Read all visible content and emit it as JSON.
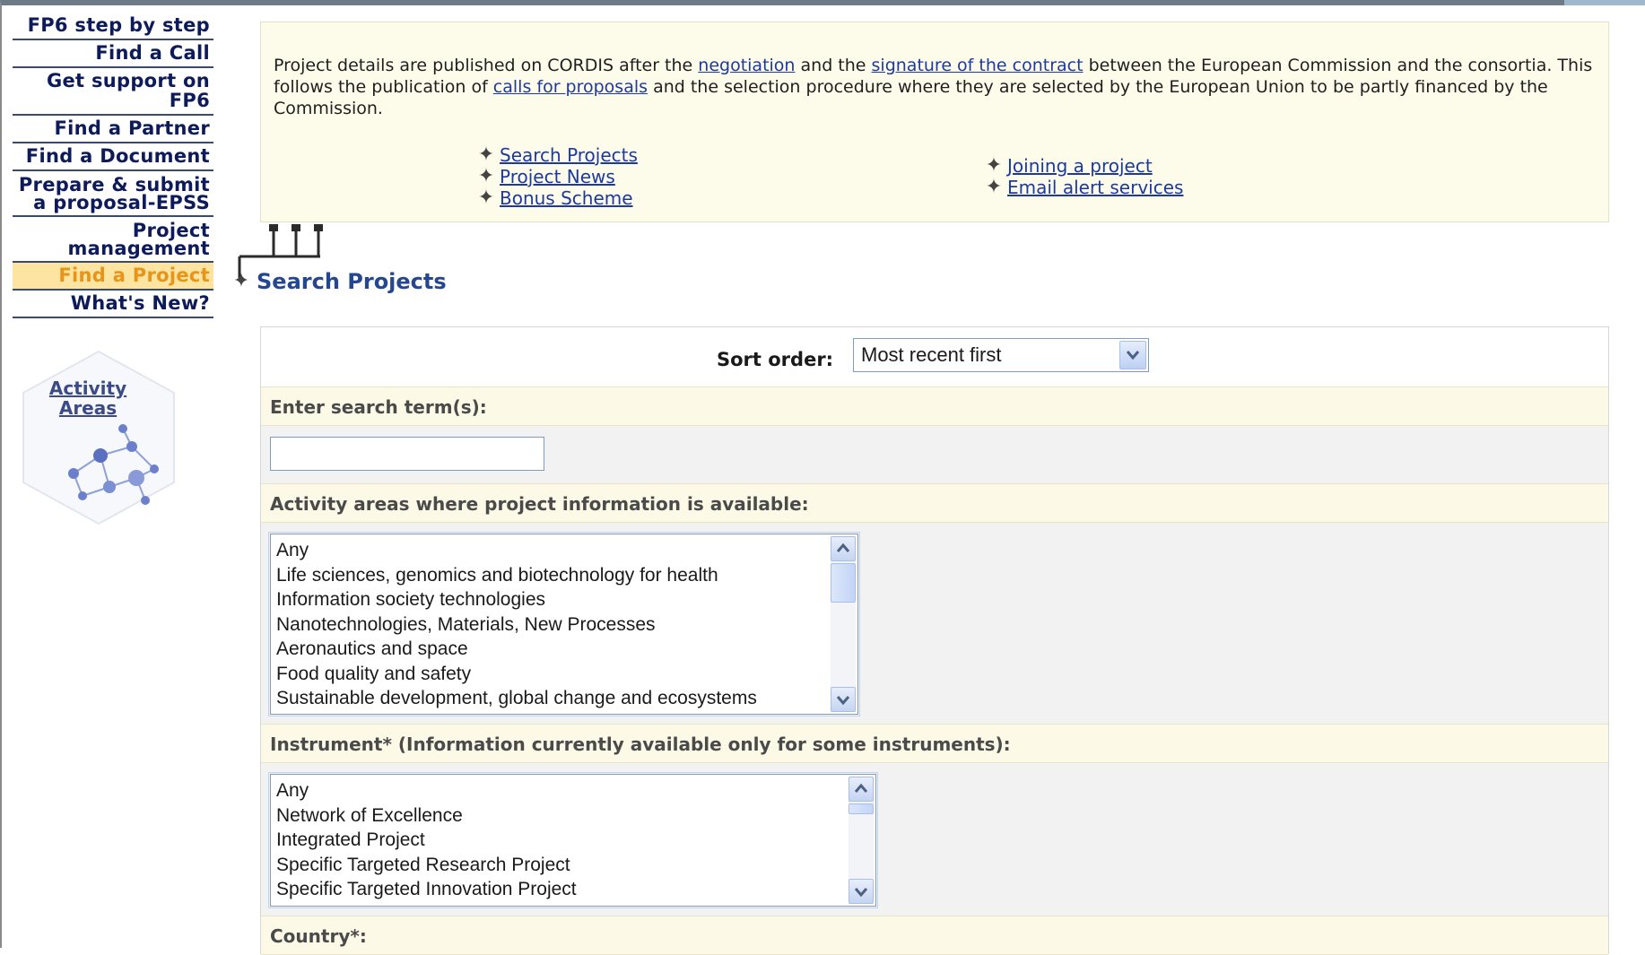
{
  "nav": {
    "items": [
      {
        "label": "FP6 step by step",
        "name": "nav-fp6-step-by-step"
      },
      {
        "label": "Find a Call",
        "name": "nav-find-a-call"
      },
      {
        "label": "Get support on FP6",
        "name": "nav-get-support"
      },
      {
        "label": "Find a Partner",
        "name": "nav-find-a-partner"
      },
      {
        "label": "Find a Document",
        "name": "nav-find-a-document"
      },
      {
        "label": "Prepare & submit",
        "label2": "a proposal-EPSS",
        "name": "nav-prepare-submit"
      },
      {
        "label": "Project",
        "label2": "management",
        "name": "nav-project-management"
      },
      {
        "label": "Find a Project",
        "name": "nav-find-a-project",
        "active": true
      },
      {
        "label": "What's New?",
        "name": "nav-whats-new"
      }
    ],
    "activity_line1": "Activity",
    "activity_line2": "Areas"
  },
  "intro": {
    "part1": "Project details are published on CORDIS after the ",
    "link_negotiation": "negotiation",
    "part2": " and the ",
    "link_signature": "signature of the contract",
    "part3": " between the European Commission and the consortia. This follows the publication of ",
    "link_calls": "calls for proposals",
    "part4": " and the selection procedure where they are selected by the European Union to be partly financed by the Commission."
  },
  "links": {
    "search_projects": "Search Projects",
    "project_news": "Project News",
    "bonus_scheme": "Bonus Scheme",
    "joining": "Joining a project",
    "email_alert": "Email alert services"
  },
  "section": {
    "heading": "Search Projects"
  },
  "form": {
    "sort_label": "Sort order:",
    "sort_value": "Most recent first",
    "search_label": "Enter search term(s):",
    "search_value": "",
    "activity_label": "Activity areas where project information is available:",
    "activity_options": [
      "Any",
      "Life sciences, genomics and biotechnology for health",
      "Information society technologies",
      "Nanotechnologies, Materials, New Processes",
      "Aeronautics and space",
      "Food quality and safety",
      "Sustainable development, global change and ecosystems"
    ],
    "instrument_label": "Instrument* (Information currently available only for some instruments):",
    "instrument_options": [
      "Any",
      "Network of Excellence",
      "Integrated Project",
      "Specific Targeted Research Project",
      "Specific Targeted Innovation Project"
    ],
    "country_label": "Country*:"
  },
  "icons": {
    "bullet": "four-point-cross-icon",
    "dropdown": "chevron-down-icon",
    "scroll_up": "chevron-up-icon",
    "scroll_down": "chevron-down-icon",
    "activity_graphic": "molecule-network-icon"
  },
  "colors": {
    "nav_text": "#0d1b5a",
    "nav_active_bg": "#fde4a0",
    "nav_active_text": "#e7941a",
    "link": "#1c3a9e",
    "heading": "#24478f",
    "panel_bg": "#fdfbea"
  }
}
